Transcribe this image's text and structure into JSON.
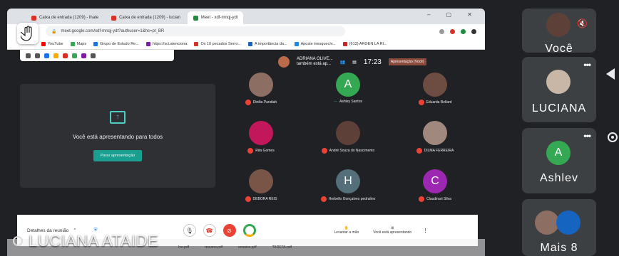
{
  "browser": {
    "tabs": [
      "Caixa de entrada (1209) - lhate",
      "Caixa de entrada (1209) - lucian",
      "Meet - xdf-mnqj-ydt"
    ],
    "url": "meet.google.com/xdf-mnqj-ydt?authuser=1&hs=pt_BR",
    "bookmarks": [
      "YouTube",
      "Maps",
      "Grupo de Estudo Re...",
      "https://sci.atenciona",
      "Os 10 pecados Serro...",
      "A importância da...",
      "Aposte inesquecív...",
      "(613) ARGEN LA RI..."
    ]
  },
  "meet": {
    "top": {
      "presenter_name": "ADRIANA OLIVE...",
      "presenter_sub": "também está ap...",
      "time": "17:23",
      "badge": "Apresentação (Você)"
    },
    "presenting_text": "Você está apresentando para todos",
    "stop_button": "Parar apresentação",
    "participants": [
      {
        "name": "Dinilia Pandiah",
        "initial": "",
        "color": "#8d6e63"
      },
      {
        "name": "Ashley Santos",
        "initial": "A",
        "color": "#34a853"
      },
      {
        "name": "Eduarda Bellard",
        "initial": "",
        "color": "#6d4c41"
      },
      {
        "name": "Rita Gomes",
        "initial": "",
        "color": "#c2185b"
      },
      {
        "name": "André Souza do Nascimento",
        "initial": "",
        "color": "#5d4037"
      },
      {
        "name": "DILMA FERREIRA",
        "initial": "",
        "color": "#a1887f"
      },
      {
        "name": "DEBORA REIS",
        "initial": "",
        "color": "#795548"
      },
      {
        "name": "Herbello Gonçalves pedralino",
        "initial": "H",
        "color": "#546e7a"
      },
      {
        "name": "Claudinari Silva",
        "initial": "C",
        "color": "#9c27b0"
      }
    ],
    "controls": {
      "details": "Detalhes da reunião",
      "raise_hand": "Levantar a mão",
      "presenting": "Você está apresentando"
    }
  },
  "overlay": {
    "speaker_name": "LUCIANA ATAIDE"
  },
  "downloads": [
    "Ivo.pdf",
    "resumo.pdf",
    "ensaios.pdf",
    "TAREFA.pdf"
  ],
  "side_panel": {
    "tiles": [
      {
        "label": "Você"
      },
      {
        "label": "LUCIANA"
      },
      {
        "label": "Ashlev",
        "initial": "A"
      },
      {
        "label": "Mais 8"
      }
    ]
  }
}
